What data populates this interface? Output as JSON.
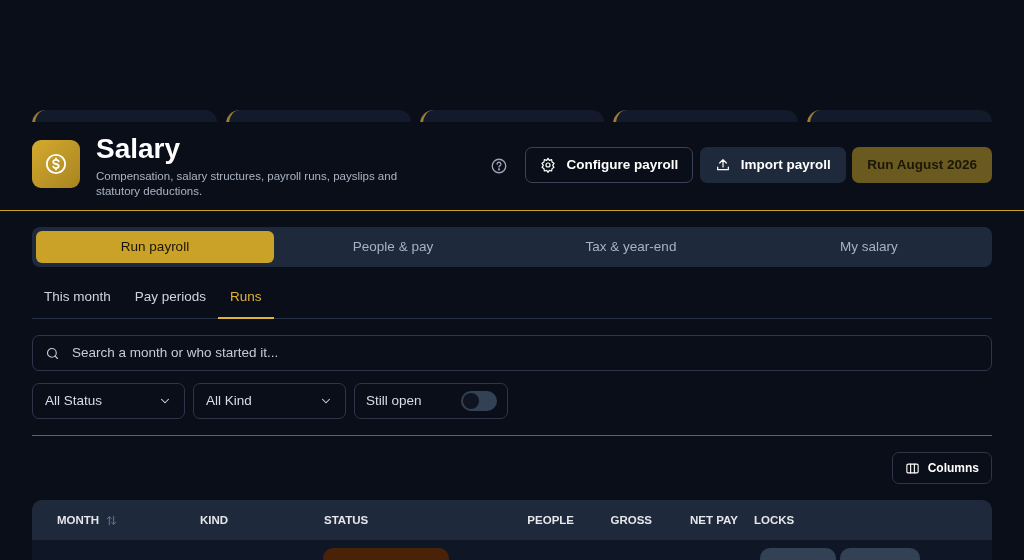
{
  "header": {
    "title": "Salary",
    "subtitle": "Compensation, salary structures, payroll runs, payslips and statutory deductions."
  },
  "actions": [
    {
      "kind": "help"
    },
    {
      "kind": "outline",
      "label": "Configure payroll"
    },
    {
      "kind": "secondary",
      "label": "Import payroll"
    },
    {
      "kind": "primary",
      "label": "Run August 2026",
      "disabled": true
    }
  ],
  "tabs": [
    {
      "label": "Run payroll",
      "selected": true
    },
    {
      "label": "People & pay",
      "selected": false
    },
    {
      "label": "Tax & year-end",
      "selected": false
    },
    {
      "label": "My salary",
      "selected": false
    }
  ],
  "subtabs": [
    {
      "label": "This month",
      "selected": false
    },
    {
      "label": "Pay periods",
      "selected": false
    },
    {
      "label": "Runs",
      "selected": true
    }
  ],
  "search": {
    "placeholder": "Search a month or who started it..."
  },
  "filters": [
    {
      "kind": "select",
      "value": "All Status"
    },
    {
      "kind": "select",
      "value": "All Kind"
    },
    {
      "kind": "toggle",
      "label": "Still open",
      "on": false
    }
  ],
  "columns_button": {
    "label": "Columns"
  },
  "table": {
    "columns": [
      {
        "label": "MONTH",
        "sortable": true
      },
      {
        "label": "KIND",
        "sortable": false
      },
      {
        "label": "STATUS",
        "sortable": false
      },
      {
        "label": "PEOPLE",
        "sortable": false
      },
      {
        "label": "GROSS",
        "sortable": false
      },
      {
        "label": "NET PAY",
        "sortable": false
      },
      {
        "label": "LOCKS",
        "sortable": false
      }
    ]
  }
}
